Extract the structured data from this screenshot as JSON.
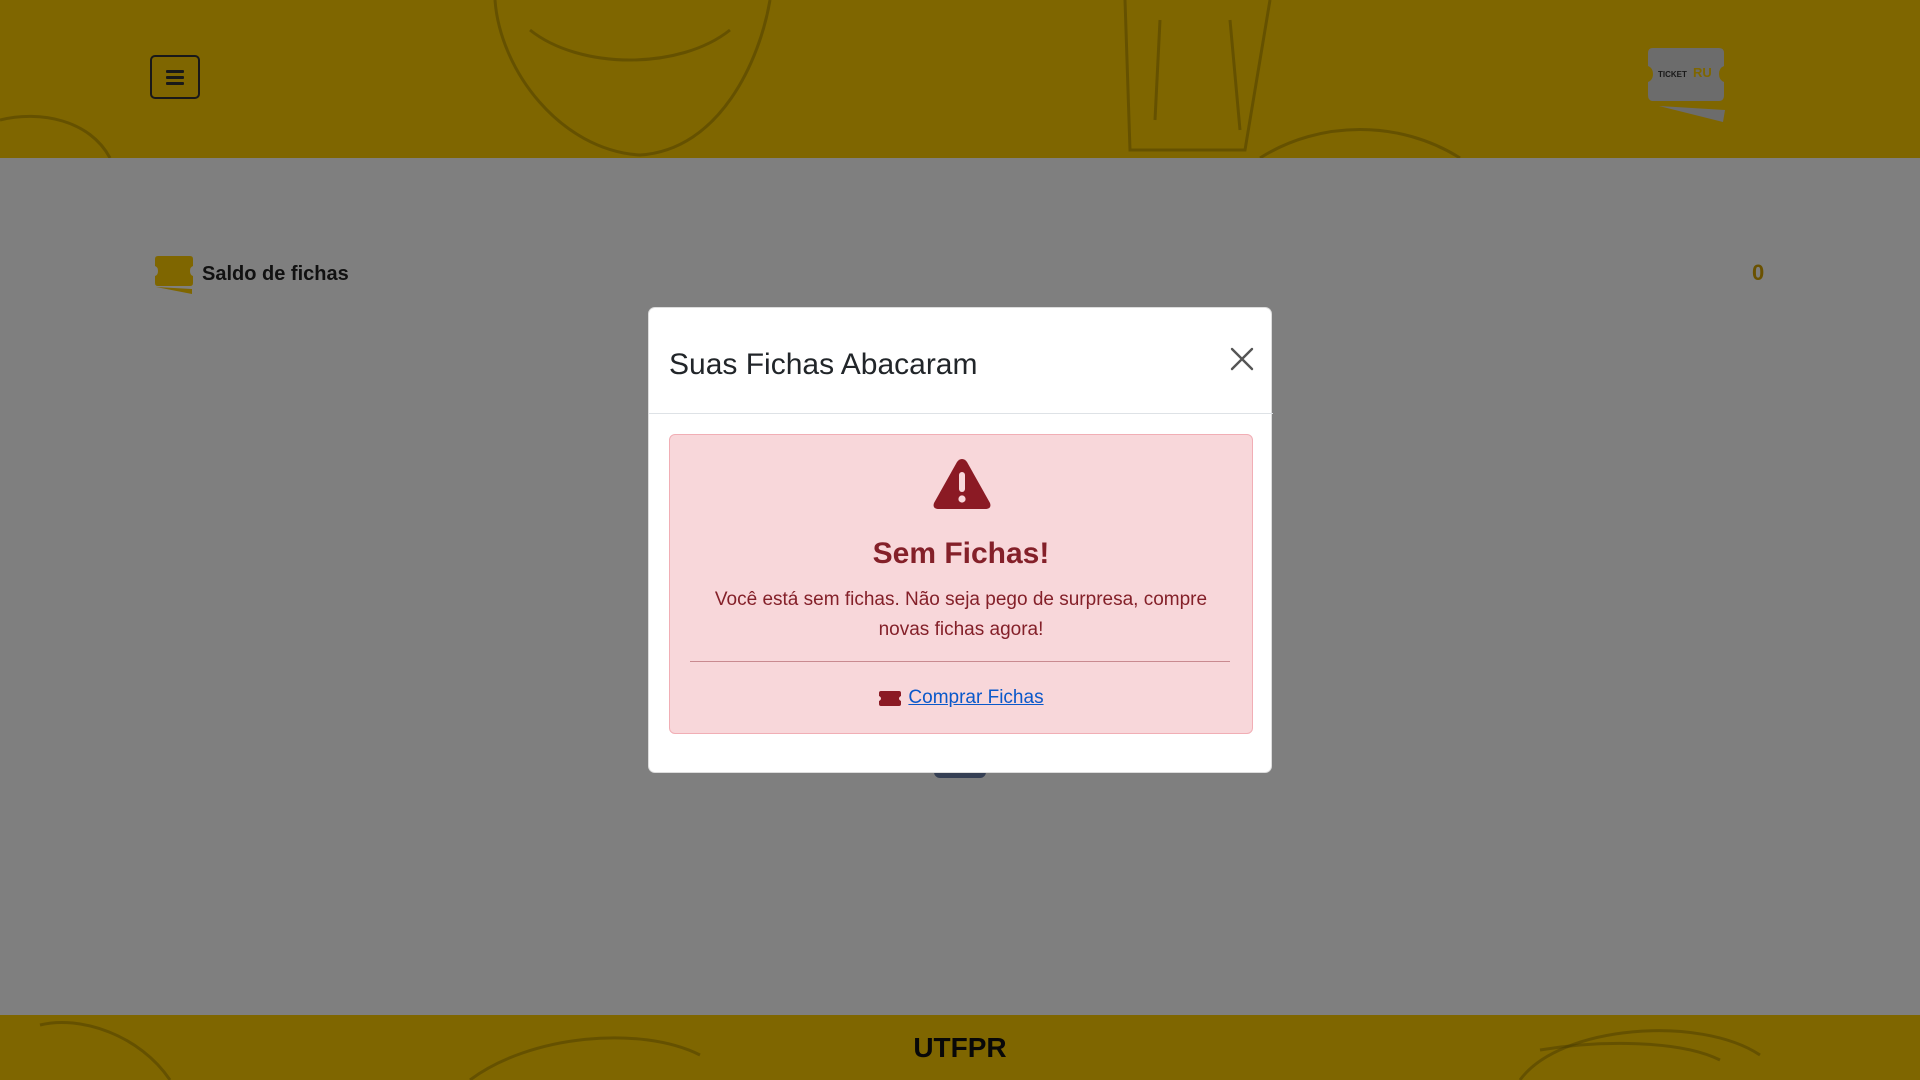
{
  "header": {
    "menu_icon": "hamburger-icon",
    "logo": {
      "small_text": "TICKET",
      "accent_text": "RU"
    }
  },
  "balance": {
    "icon": "ticket-icon",
    "label": "Saldo de fichas",
    "value": "0"
  },
  "footer": {
    "text": "UTFPR"
  },
  "modal": {
    "title": "Suas Fichas Abacaram",
    "close_icon": "close-icon",
    "alert": {
      "icon": "warning-triangle-icon",
      "heading": "Sem Fichas!",
      "message": "Você está sem fichas. Não seja pego de surpresa, compre novas fichas agora!",
      "link_icon": "ticket-icon",
      "link_label": "Comprar Fichas"
    }
  },
  "colors": {
    "brand_yellow": "#ffcc00",
    "alert_bg": "#f8d7da",
    "alert_text": "#842029",
    "link": "#0a58ca",
    "balance_value": "#d4a300"
  }
}
